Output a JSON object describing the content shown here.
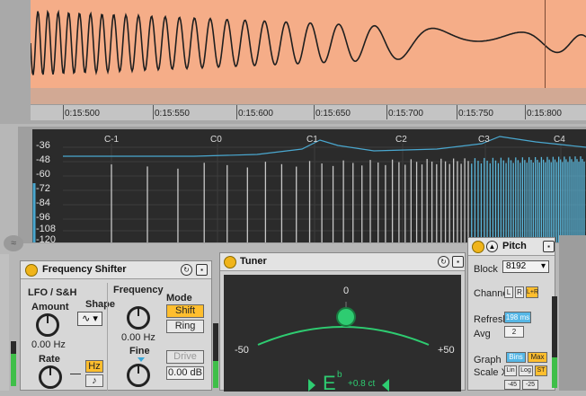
{
  "waveform": {
    "timeline_ticks": [
      "0:15:500",
      "0:15:550",
      "0:15:600",
      "0:15:650",
      "0:15:700",
      "0:15:750",
      "0:15:800"
    ]
  },
  "spectrum": {
    "db_labels": [
      "-36",
      "-48",
      "-60",
      "-72",
      "-84",
      "-96",
      "-108",
      "-120"
    ],
    "note_labels": [
      "C-1",
      "C0",
      "C1",
      "C2",
      "C3",
      "C4"
    ]
  },
  "frequency_shifter": {
    "title": "Frequency Shifter",
    "lfo_label": "LFO / S&H",
    "amount_label": "Amount",
    "amount_value": "0.00 Hz",
    "shape_label": "Shape",
    "rate_label": "Rate",
    "hz_button": "Hz",
    "note_button": "♪",
    "frequency_label": "Frequency",
    "frequency_value": "0.00 Hz",
    "fine_label": "Fine",
    "mode_label": "Mode",
    "shift_button": "Shift",
    "ring_button": "Ring",
    "drive_button": "Drive",
    "drive_value": "0.00 dB"
  },
  "tuner": {
    "title": "Tuner",
    "scale_left": "-50",
    "scale_center": "0",
    "scale_right": "+50",
    "note": "E",
    "note_accidental": "b",
    "cents": "+0.8 ct"
  },
  "pitch": {
    "title": "Pitch",
    "block_label": "Block",
    "block_value": "8192",
    "channel_label": "Channel",
    "channel_l": "L",
    "channel_r": "R",
    "channel_lr": "L+R",
    "refresh_label": "Refresh",
    "refresh_value": "198 ms",
    "avg_label": "Avg",
    "avg_value": "2",
    "graph_label": "Graph",
    "graph_bins": "Bins",
    "graph_max": "Max",
    "scalex_label": "Scale X",
    "scalex_lin": "Lin",
    "scalex_log": "Log",
    "scalex_st": "ST",
    "bottom_values": [
      "-45",
      "-25"
    ]
  }
}
